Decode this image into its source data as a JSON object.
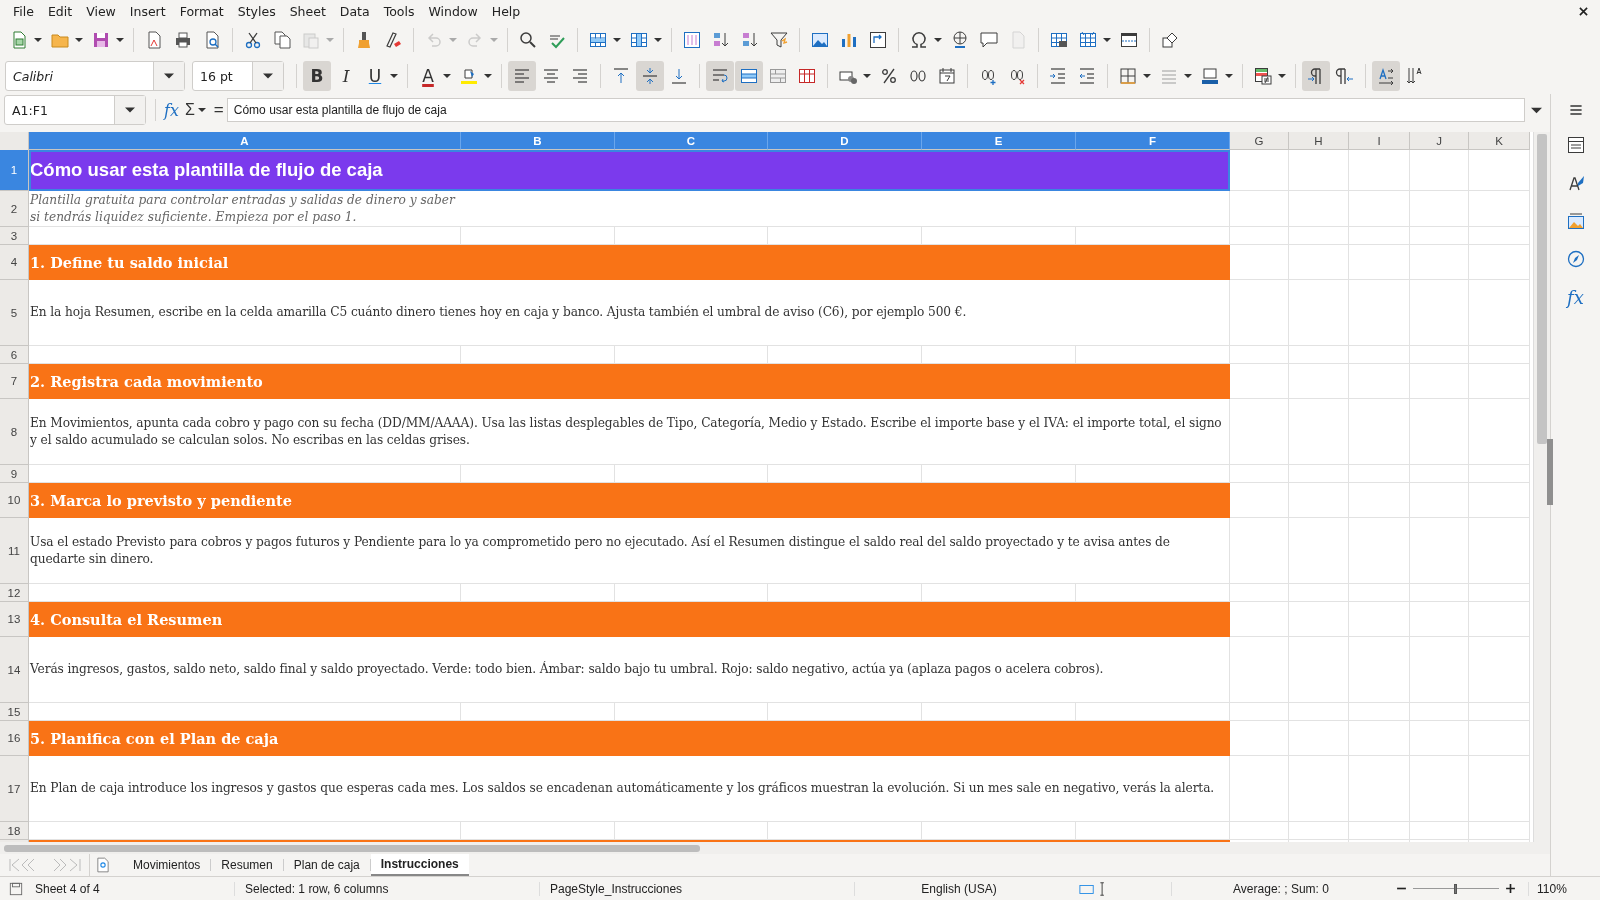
{
  "menu": [
    "File",
    "Edit",
    "View",
    "Insert",
    "Format",
    "Styles",
    "Sheet",
    "Data",
    "Tools",
    "Window",
    "Help"
  ],
  "toolbar_1": [
    [
      {
        "kind": "new",
        "dropdown": true,
        "disabled": false
      },
      {
        "kind": "open",
        "dropdown": true,
        "disabled": false
      },
      {
        "kind": "save",
        "dropdown": true,
        "disabled": false
      }
    ],
    [
      {
        "kind": "export-pdf",
        "dropdown": false,
        "disabled": false
      },
      {
        "kind": "print",
        "dropdown": false,
        "disabled": false
      },
      {
        "kind": "print-preview",
        "dropdown": false,
        "disabled": false
      }
    ],
    [
      {
        "kind": "cut",
        "dropdown": false,
        "disabled": false
      },
      {
        "kind": "copy",
        "dropdown": false,
        "disabled": false
      },
      {
        "kind": "paste",
        "dropdown": true,
        "disabled": true
      }
    ],
    [
      {
        "kind": "clone-formatting",
        "dropdown": false,
        "disabled": false
      },
      {
        "kind": "clear-formatting",
        "dropdown": false,
        "disabled": false
      }
    ],
    [
      {
        "kind": "undo",
        "dropdown": true,
        "disabled": true
      },
      {
        "kind": "redo",
        "dropdown": true,
        "disabled": true
      }
    ],
    [
      {
        "kind": "find-replace",
        "dropdown": false,
        "disabled": false
      },
      {
        "kind": "spelling",
        "dropdown": false,
        "disabled": false
      }
    ],
    [
      {
        "kind": "insert-row",
        "dropdown": true,
        "disabled": false
      },
      {
        "kind": "insert-column",
        "dropdown": true,
        "disabled": false
      }
    ],
    [
      {
        "kind": "sort",
        "dropdown": false,
        "disabled": false
      },
      {
        "kind": "sort-ascending",
        "dropdown": false,
        "disabled": false
      },
      {
        "kind": "sort-descending",
        "dropdown": false,
        "disabled": false
      },
      {
        "kind": "autofilter",
        "dropdown": false,
        "disabled": false
      }
    ],
    [
      {
        "kind": "insert-image",
        "dropdown": false,
        "disabled": false
      },
      {
        "kind": "insert-chart",
        "dropdown": false,
        "disabled": false
      },
      {
        "kind": "pivot-table",
        "dropdown": false,
        "disabled": false
      }
    ],
    [
      {
        "kind": "special-character",
        "dropdown": true,
        "disabled": false
      },
      {
        "kind": "hyperlink",
        "dropdown": false,
        "disabled": false
      },
      {
        "kind": "comment",
        "dropdown": false,
        "disabled": false
      },
      {
        "kind": "header-footer",
        "dropdown": false,
        "disabled": true
      }
    ],
    [
      {
        "kind": "print-area",
        "dropdown": false,
        "disabled": false
      },
      {
        "kind": "freeze",
        "dropdown": true,
        "disabled": false
      },
      {
        "kind": "split-window",
        "dropdown": false,
        "disabled": false
      }
    ],
    [
      {
        "kind": "shapes",
        "dropdown": false,
        "disabled": false
      }
    ]
  ],
  "font_name": "Calibri",
  "font_size": "16 pt",
  "toolbar_2": [
    [
      {
        "kind": "bold",
        "label": "B",
        "dropdown": false,
        "pressed": true
      },
      {
        "kind": "italic",
        "label": "I",
        "dropdown": false,
        "pressed": false
      },
      {
        "kind": "underline",
        "label": "U",
        "dropdown": true,
        "pressed": false
      }
    ],
    [
      {
        "kind": "font-color",
        "label": "A",
        "dropdown": true,
        "pressed": false
      },
      {
        "kind": "highlight",
        "dropdown": true,
        "pressed": false
      }
    ],
    [
      {
        "kind": "align-left",
        "dropdown": false,
        "pressed": true
      },
      {
        "kind": "align-center",
        "dropdown": false,
        "pressed": false
      },
      {
        "kind": "align-right",
        "dropdown": false,
        "pressed": false
      }
    ],
    [
      {
        "kind": "align-top",
        "dropdown": false,
        "pressed": false
      },
      {
        "kind": "align-middle",
        "dropdown": false,
        "pressed": true
      },
      {
        "kind": "align-bottom",
        "dropdown": false,
        "pressed": false
      }
    ],
    [
      {
        "kind": "wrap-text",
        "dropdown": false,
        "pressed": true
      },
      {
        "kind": "merge-center",
        "dropdown": false,
        "pressed": true
      },
      {
        "kind": "merge-cells",
        "dropdown": false,
        "pressed": false
      },
      {
        "kind": "unmerge-cells",
        "dropdown": false,
        "pressed": false
      }
    ],
    [
      {
        "kind": "currency",
        "dropdown": true,
        "pressed": false
      },
      {
        "kind": "percent",
        "dropdown": false,
        "pressed": false
      },
      {
        "kind": "number",
        "dropdown": false,
        "pressed": false
      },
      {
        "kind": "date",
        "dropdown": false,
        "pressed": false
      }
    ],
    [
      {
        "kind": "add-decimal",
        "dropdown": false,
        "pressed": false
      },
      {
        "kind": "delete-decimal",
        "dropdown": false,
        "pressed": false
      }
    ],
    [
      {
        "kind": "increase-indent",
        "dropdown": false,
        "pressed": false
      },
      {
        "kind": "decrease-indent",
        "dropdown": false,
        "pressed": false
      }
    ],
    [
      {
        "kind": "borders",
        "dropdown": true,
        "pressed": false
      },
      {
        "kind": "border-style",
        "dropdown": true,
        "pressed": false
      },
      {
        "kind": "border-color",
        "dropdown": true,
        "pressed": false
      }
    ],
    [
      {
        "kind": "conditional",
        "dropdown": true,
        "pressed": false
      }
    ],
    [
      {
        "kind": "left-to-right",
        "dropdown": false,
        "pressed": true
      },
      {
        "kind": "right-to-left",
        "dropdown": false,
        "pressed": false
      }
    ],
    [
      {
        "kind": "text-direction",
        "dropdown": false,
        "pressed": true
      },
      {
        "kind": "vertical-text",
        "dropdown": false,
        "pressed": false
      }
    ]
  ],
  "formula_bar": {
    "name_box": "A1:F1",
    "wizard": "fx",
    "sum": "Σ",
    "equals": "=",
    "content": "Cómo usar esta plantilla de flujo de caja"
  },
  "columns": [
    {
      "label": "A",
      "selected": true
    },
    {
      "label": "B",
      "selected": true
    },
    {
      "label": "C",
      "selected": true
    },
    {
      "label": "D",
      "selected": true
    },
    {
      "label": "E",
      "selected": true
    },
    {
      "label": "F",
      "selected": true
    },
    {
      "label": "G",
      "selected": false
    },
    {
      "label": "H",
      "selected": false
    },
    {
      "label": "I",
      "selected": false
    },
    {
      "label": "J",
      "selected": false
    },
    {
      "label": "K",
      "selected": false
    }
  ],
  "rows": [
    {
      "number": "1",
      "selected": true,
      "kind": "title",
      "text": "Cómo usar esta plantilla de flujo de caja"
    },
    {
      "number": "2",
      "selected": false,
      "kind": "subtitle",
      "text": "Plantilla gratuita para controlar entradas y salidas de dinero y saber si tendrás liquidez suficiente. Empieza por el paso 1."
    },
    {
      "number": "3",
      "selected": false,
      "kind": "blank"
    },
    {
      "number": "4",
      "selected": false,
      "kind": "heading",
      "text": "1. Define tu saldo inicial"
    },
    {
      "number": "5",
      "selected": false,
      "kind": "body",
      "text": "En la hoja Resumen, escribe en la celda amarilla C5 cuánto dinero tienes hoy en caja y banco. Ajusta también el umbral de aviso (C6), por ejemplo 500 €."
    },
    {
      "number": "6",
      "selected": false,
      "kind": "blank"
    },
    {
      "number": "7",
      "selected": false,
      "kind": "heading",
      "text": "2. Registra cada movimiento"
    },
    {
      "number": "8",
      "selected": false,
      "kind": "body",
      "text": "En Movimientos, apunta cada cobro y pago con su fecha (DD/MM/AAAA). Usa las listas desplegables de Tipo, Categoría, Medio y Estado. Escribe el importe base y el IVA: el importe total, el signo y el saldo acumulado se calculan solos. No escribas en las celdas grises."
    },
    {
      "number": "9",
      "selected": false,
      "kind": "blank"
    },
    {
      "number": "10",
      "selected": false,
      "kind": "heading",
      "text": "3. Marca lo previsto y pendiente"
    },
    {
      "number": "11",
      "selected": false,
      "kind": "body",
      "text": "Usa el estado Previsto para cobros y pagos futuros y Pendiente para lo ya comprometido pero no ejecutado. Así el Resumen distingue el saldo real del saldo proyectado y te avisa antes de quedarte sin dinero."
    },
    {
      "number": "12",
      "selected": false,
      "kind": "blank"
    },
    {
      "number": "13",
      "selected": false,
      "kind": "heading",
      "text": "4. Consulta el Resumen"
    },
    {
      "number": "14",
      "selected": false,
      "kind": "body",
      "text": "Verás ingresos, gastos, saldo neto, saldo final y saldo proyectado. Verde: todo bien. Ámbar: saldo bajo tu umbral. Rojo: saldo negativo, actúa ya (aplaza pagos o acelera cobros)."
    },
    {
      "number": "15",
      "selected": false,
      "kind": "blank"
    },
    {
      "number": "16",
      "selected": false,
      "kind": "heading",
      "text": "5. Planifica con el Plan de caja"
    },
    {
      "number": "17",
      "selected": false,
      "kind": "body",
      "text": "En Plan de caja introduce los ingresos y gastos que esperas cada mes. Los saldos se encadenan automáticamente y los gráficos muestran la evolución. Si un mes sale en negativo, verás la alerta."
    },
    {
      "number": "18",
      "selected": false,
      "kind": "blank"
    },
    {
      "selected": false,
      "kind": "heading"
    }
  ],
  "sheet_tabs": [
    {
      "label": "Movimientos",
      "selected": false
    },
    {
      "label": "Resumen",
      "selected": false
    },
    {
      "label": "Plan de caja",
      "selected": false
    },
    {
      "label": "Instrucciones",
      "selected": true
    }
  ],
  "sidebar": [
    {
      "kind": "properties"
    },
    {
      "kind": "styles"
    },
    {
      "kind": "gallery"
    },
    {
      "kind": "navigator"
    },
    {
      "kind": "functions",
      "label": "fx"
    }
  ],
  "status_bar": {
    "sheet": "Sheet 4 of 4",
    "selection": "Selected: 1 row, 6 columns",
    "page_style": "PageStyle_Instrucciones",
    "language": "English (USA)",
    "sum": "Average: ; Sum: 0",
    "zoom": {
      "level": 0.5,
      "reading": "110%"
    }
  }
}
